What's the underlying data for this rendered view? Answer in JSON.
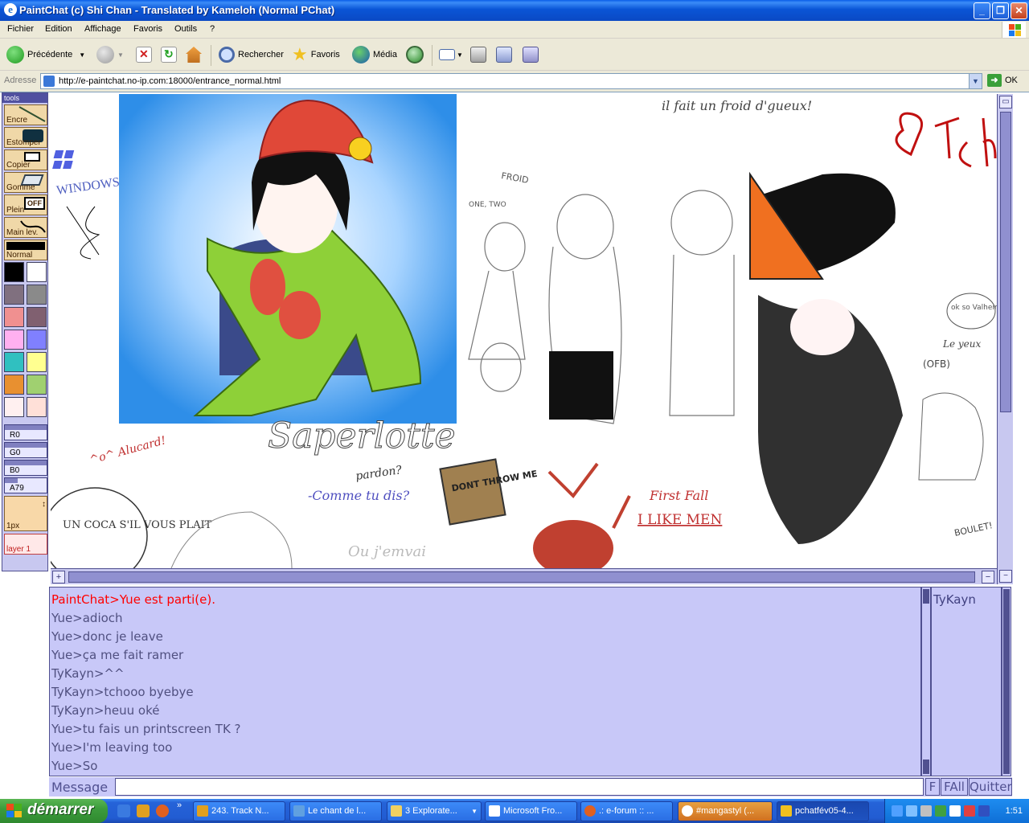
{
  "window": {
    "title": "PaintChat (c) Shi Chan - Translated by Kameloh (Normal PChat)",
    "minimize": "_",
    "maximize": "❐",
    "close": "✕"
  },
  "menu": [
    "Fichier",
    "Edition",
    "Affichage",
    "Favoris",
    "Outils",
    "?"
  ],
  "toolbar": {
    "back": "Précédente",
    "search": "Rechercher",
    "favorites": "Favoris",
    "media": "Média"
  },
  "address": {
    "label": "Adresse",
    "url": "http://e-paintchat.no-ip.com:18000/entrance_normal.html",
    "go": "OK"
  },
  "tools": {
    "header": "tools",
    "buttons": [
      "Encre",
      "Estomper",
      "Copier",
      "Gomme",
      "Plein",
      "Main lev."
    ],
    "mode": "Normal",
    "swatches": [
      "#000000",
      "#ffffff",
      "#80707f",
      "#8a8a8a",
      "#f09090",
      "#806070",
      "#ffb0f0",
      "#8080ff",
      "#30c0c0",
      "#ffff90",
      "#e89030",
      "#a0d070",
      "#fff0f0",
      "#ffe0d8"
    ],
    "sliders": [
      "R0",
      "G0",
      "B0",
      "A79"
    ],
    "pen_size": "1px",
    "layer": "layer 1"
  },
  "canvas_text": {
    "windows": "WINDOWS",
    "froid": "il fait un froid d'gueux!",
    "saperlotte": "Saperlotte",
    "alucard": "^o^ Alucard!",
    "pardon": "pardon?",
    "comme": "-Comme tu dis?",
    "coca": "UN COCA S'IL VOUS PLAIT",
    "dont_throw": "DONT THROW ME",
    "first_fall": "First Fall",
    "like_men": "I LIKE MEN",
    "ok_valheim": "ok so Valheim",
    "le_yeux": "Le yeux",
    "ofb": "(OFB)",
    "boulet": "BOULET!",
    "one_two": "ONE, TWO",
    "froid_bubble": "FROID",
    "ou_jemenvai": "Ou j'emvai"
  },
  "chat": {
    "lines": [
      {
        "text": "PaintChat>Yue est parti(e).",
        "color": "#ff0000"
      },
      {
        "text": "Yue>adioch",
        "color": "#505080"
      },
      {
        "text": "Yue>donc je leave",
        "color": "#505080"
      },
      {
        "text": "Yue>ça me fait ramer",
        "color": "#505080"
      },
      {
        "text": "TyKayn>^^",
        "color": "#505080"
      },
      {
        "text": "TyKayn>tchooo byebye",
        "color": "#505080"
      },
      {
        "text": "TyKayn>heuu oké",
        "color": "#505080"
      },
      {
        "text": "Yue>tu fais un printscreen TK ?",
        "color": "#505080"
      },
      {
        "text": "Yue>I'm leaving too",
        "color": "#505080"
      },
      {
        "text": "Yue>So",
        "color": "#505080"
      }
    ],
    "users": [
      "TyKayn"
    ],
    "message_label": "Message",
    "buttons": [
      "F",
      "FAll",
      "Quitter"
    ]
  },
  "taskbar": {
    "start": "démarrer",
    "tasks": [
      "243. Track N...",
      "Le chant de l...",
      "3 Explorate...",
      "Microsoft Fro...",
      ".: e-forum :: ...",
      "#mangastyl (...",
      "pchatfév05-4..."
    ],
    "clock": "1:51"
  }
}
